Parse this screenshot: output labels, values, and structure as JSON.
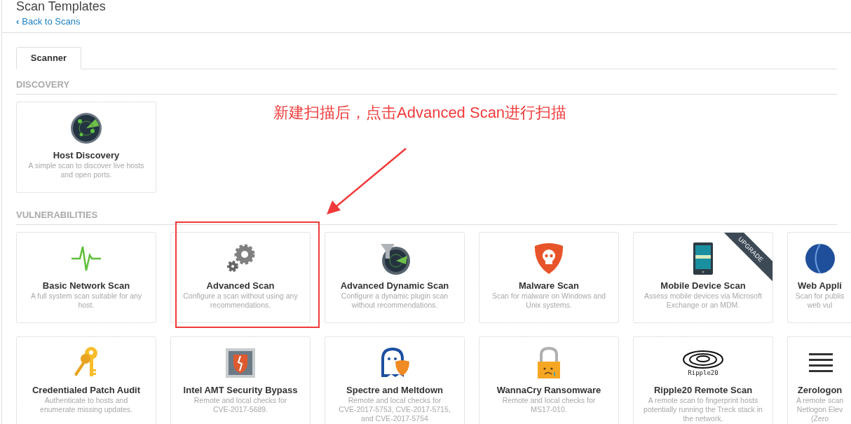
{
  "page_title": "Scan Templates",
  "back_link": {
    "arrow": "‹",
    "label": "Back to Scans"
  },
  "tabs": [
    {
      "label": "Scanner",
      "selected": true
    }
  ],
  "sections": [
    {
      "heading": "DISCOVERY",
      "templates": [
        {
          "kind": "radar",
          "title": "Host Discovery",
          "description": [
            "A simple scan to discover live hosts",
            "and open ports."
          ],
          "upgrade": false,
          "cut": false
        }
      ]
    },
    {
      "heading": "VULNERABILITIES",
      "templates": [
        {
          "kind": "pulse",
          "title": "Basic Network Scan",
          "description": [
            "A full system scan suitable for any",
            "host."
          ],
          "upgrade": false,
          "cut": false
        },
        {
          "kind": "gears",
          "title": "Advanced Scan",
          "description": [
            "Configure a scan without using any",
            "recommendations."
          ],
          "upgrade": false,
          "cut": false
        },
        {
          "kind": "funnel-radar",
          "title": "Advanced Dynamic Scan",
          "description": [
            "Configure a dynamic plugin scan",
            "without recommendations."
          ],
          "upgrade": false,
          "cut": false
        },
        {
          "kind": "skull-shield",
          "title": "Malware Scan",
          "description": [
            "Scan for malware on Windows and",
            "Unix systems."
          ],
          "upgrade": false,
          "cut": false
        },
        {
          "kind": "phone",
          "title": "Mobile Device Scan",
          "description": [
            "Assess mobile devices via Microsoft",
            "Exchange or an MDM."
          ],
          "upgrade": true,
          "upgrade_label": "UPGRADE",
          "cut": false
        },
        {
          "kind": "globe",
          "title": "Web Appli",
          "description": [
            "Scan for publis",
            "web vul"
          ],
          "upgrade": false,
          "cut": true
        },
        {
          "kind": "keys",
          "title": "Credentialed Patch Audit",
          "description": [
            "Authenticate to hosts and",
            "enumerate missing updates."
          ],
          "upgrade": false,
          "cut": false
        },
        {
          "kind": "chip",
          "title": "Intel AMT Security Bypass",
          "description": [
            "Remote and local checks for",
            "CVE-2017-5689."
          ],
          "upgrade": false,
          "cut": false
        },
        {
          "kind": "ghost",
          "title": "Spectre and Meltdown",
          "description": [
            "Remote and local checks for",
            "CVE-2017-5753, CVE-2017-5715,",
            "and CVE-2017-5754"
          ],
          "upgrade": false,
          "cut": false
        },
        {
          "kind": "lock",
          "title": "WannaCry Ransomware",
          "description": [
            "Remote and local checks for",
            "MS17-010."
          ],
          "upgrade": false,
          "cut": false
        },
        {
          "kind": "ripple",
          "logo_text": "Ripple20",
          "title": "Ripple20 Remote Scan",
          "description": [
            "A remote scan to fingerprint hosts",
            "potentially running the Treck stack in",
            "the network."
          ],
          "upgrade": false,
          "cut": false
        },
        {
          "kind": "hexdump",
          "title": "Zerologon",
          "description": [
            "A remote scan",
            "Netlogon Elev",
            "(Zero"
          ],
          "upgrade": false,
          "cut": true
        }
      ]
    }
  ],
  "annotation": {
    "text": "新建扫描后，点击Advanced Scan进行扫描"
  }
}
